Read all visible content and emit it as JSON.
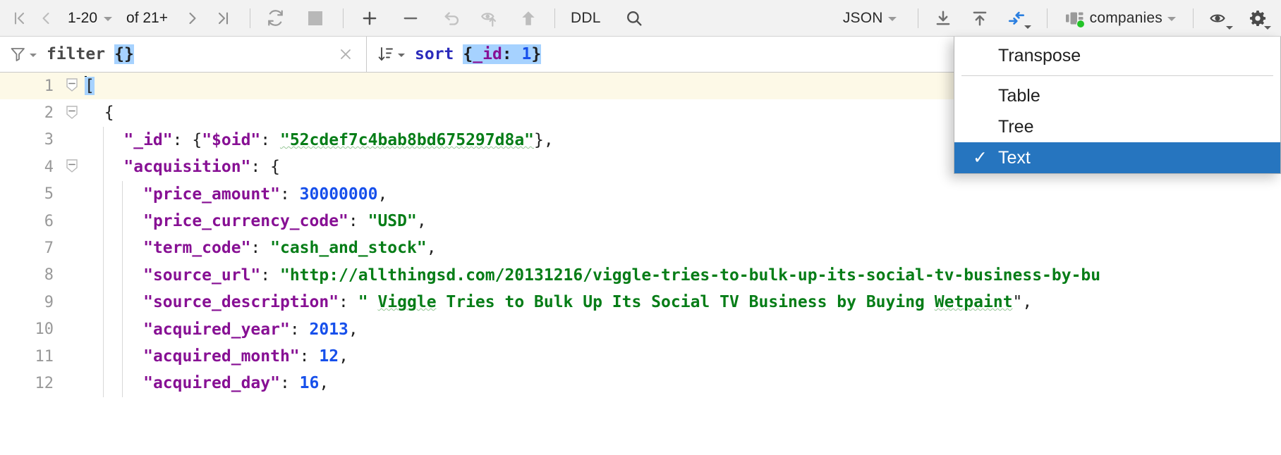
{
  "toolbar": {
    "first_page_icon": "first-page-icon",
    "prev_page_icon": "previous-page-icon",
    "page_range": "1-20",
    "of_label": "of 21+",
    "next_page_icon": "next-page-icon",
    "last_page_icon": "last-page-icon",
    "refresh_icon": "refresh-icon",
    "stop_icon": "stop-icon",
    "add_icon": "add-row-icon",
    "remove_icon": "remove-row-icon",
    "revert_icon": "revert-icon",
    "revert_selected_icon": "revert-selected-icon",
    "submit_icon": "submit-icon",
    "ddl_label": "DDL",
    "search_icon": "search-icon",
    "format_label": "JSON",
    "download_icon": "download-data-icon",
    "upload_icon": "upload-data-icon",
    "compare_icon": "compare-icon",
    "collection_icon": "collection-icon",
    "collection_label": "companies",
    "view_icon": "view-options-icon",
    "settings_icon": "settings-icon"
  },
  "filterbar": {
    "filter_icon": "filter-icon",
    "filter_label": "filter",
    "filter_value": "{}",
    "clear_icon": "clear-filter-icon",
    "sort_icon": "sort-icon",
    "sort_label": "sort",
    "sort_value_open": "{",
    "sort_value_field": "_id",
    "sort_value_colon": ": ",
    "sort_value_num": "1",
    "sort_value_close": "}"
  },
  "view_menu": {
    "items": [
      {
        "label": "Transpose",
        "checked": false,
        "selected": false
      },
      {
        "label": "Table",
        "checked": false,
        "selected": false
      },
      {
        "label": "Tree",
        "checked": false,
        "selected": false
      },
      {
        "label": "Text",
        "checked": true,
        "selected": true
      }
    ],
    "check_glyph": "✓"
  },
  "editor": {
    "line_numbers": [
      "1",
      "2",
      "3",
      "4",
      "5",
      "6",
      "7",
      "8",
      "9",
      "10",
      "11",
      "12"
    ],
    "lines": [
      {
        "num": "1",
        "indent": 0,
        "current": true,
        "fold": "minus",
        "segments": [
          {
            "t": "[",
            "c": "p",
            "caret": true
          }
        ]
      },
      {
        "num": "2",
        "indent": 0,
        "current": false,
        "fold": "minus",
        "segments": [
          {
            "t": "  {",
            "c": "p"
          }
        ]
      },
      {
        "num": "3",
        "indent": 1,
        "current": false,
        "fold": "",
        "segments": [
          {
            "t": "    ",
            "c": "p"
          },
          {
            "t": "\"_id\"",
            "c": "k"
          },
          {
            "t": ": {",
            "c": "p"
          },
          {
            "t": "\"$oid\"",
            "c": "k"
          },
          {
            "t": ": ",
            "c": "p"
          },
          {
            "t": "\"52cdef7c4bab8bd675297d8a\"",
            "c": "s",
            "wavy": true
          },
          {
            "t": "},",
            "c": "p"
          }
        ]
      },
      {
        "num": "4",
        "indent": 1,
        "current": false,
        "fold": "minus",
        "segments": [
          {
            "t": "    ",
            "c": "p"
          },
          {
            "t": "\"acquisition\"",
            "c": "k"
          },
          {
            "t": ": {",
            "c": "p"
          }
        ]
      },
      {
        "num": "5",
        "indent": 2,
        "current": false,
        "fold": "",
        "segments": [
          {
            "t": "      ",
            "c": "p"
          },
          {
            "t": "\"price_amount\"",
            "c": "k"
          },
          {
            "t": ": ",
            "c": "p"
          },
          {
            "t": "30000000",
            "c": "n"
          },
          {
            "t": ",",
            "c": "p"
          }
        ]
      },
      {
        "num": "6",
        "indent": 2,
        "current": false,
        "fold": "",
        "segments": [
          {
            "t": "      ",
            "c": "p"
          },
          {
            "t": "\"price_currency_code\"",
            "c": "k"
          },
          {
            "t": ": ",
            "c": "p"
          },
          {
            "t": "\"USD\"",
            "c": "s"
          },
          {
            "t": ",",
            "c": "p"
          }
        ]
      },
      {
        "num": "7",
        "indent": 2,
        "current": false,
        "fold": "",
        "segments": [
          {
            "t": "      ",
            "c": "p"
          },
          {
            "t": "\"term_code\"",
            "c": "k"
          },
          {
            "t": ": ",
            "c": "p"
          },
          {
            "t": "\"cash_and_stock\"",
            "c": "s"
          },
          {
            "t": ",",
            "c": "p"
          }
        ]
      },
      {
        "num": "8",
        "indent": 2,
        "current": false,
        "fold": "",
        "segments": [
          {
            "t": "      ",
            "c": "p"
          },
          {
            "t": "\"source_url\"",
            "c": "k"
          },
          {
            "t": ": ",
            "c": "p"
          },
          {
            "t": "\"http://allthingsd.com/20131216/viggle-tries-to-bulk-up-its-social-tv-business-by-bu",
            "c": "s"
          }
        ]
      },
      {
        "num": "9",
        "indent": 2,
        "current": false,
        "fold": "",
        "segments": [
          {
            "t": "      ",
            "c": "p"
          },
          {
            "t": "\"source_description\"",
            "c": "k"
          },
          {
            "t": ": ",
            "c": "p"
          },
          {
            "t": "\" ",
            "c": "s"
          },
          {
            "t": "Viggle",
            "c": "s",
            "wavy": true
          },
          {
            "t": " Tries to Bulk Up Its Social TV Business by Buying ",
            "c": "s"
          },
          {
            "t": "Wetpaint",
            "c": "s",
            "wavy": true
          },
          {
            "t": "\",",
            "c": "p"
          }
        ]
      },
      {
        "num": "10",
        "indent": 2,
        "current": false,
        "fold": "",
        "segments": [
          {
            "t": "      ",
            "c": "p"
          },
          {
            "t": "\"acquired_year\"",
            "c": "k"
          },
          {
            "t": ": ",
            "c": "p"
          },
          {
            "t": "2013",
            "c": "n"
          },
          {
            "t": ",",
            "c": "p"
          }
        ]
      },
      {
        "num": "11",
        "indent": 2,
        "current": false,
        "fold": "",
        "segments": [
          {
            "t": "      ",
            "c": "p"
          },
          {
            "t": "\"acquired_month\"",
            "c": "k"
          },
          {
            "t": ": ",
            "c": "p"
          },
          {
            "t": "12",
            "c": "n"
          },
          {
            "t": ",",
            "c": "p"
          }
        ]
      },
      {
        "num": "12",
        "indent": 2,
        "current": false,
        "fold": "",
        "segments": [
          {
            "t": "      ",
            "c": "p"
          },
          {
            "t": "\"acquired_day\"",
            "c": "k"
          },
          {
            "t": ": ",
            "c": "p"
          },
          {
            "t": "16",
            "c": "n"
          },
          {
            "t": ",",
            "c": "p"
          }
        ]
      }
    ]
  },
  "colors": {
    "toolbar_bg": "#f2f2f2",
    "editor_bg": "#ffffff",
    "current_line_bg": "#fdf9e7",
    "selection_bg": "#a6d2ff",
    "menu_selected_bg": "#2675bf",
    "key_color": "#871094",
    "string_color": "#067d17",
    "number_color": "#1750eb",
    "accent_blue": "#2b7fe0",
    "status_green": "#23c328"
  }
}
